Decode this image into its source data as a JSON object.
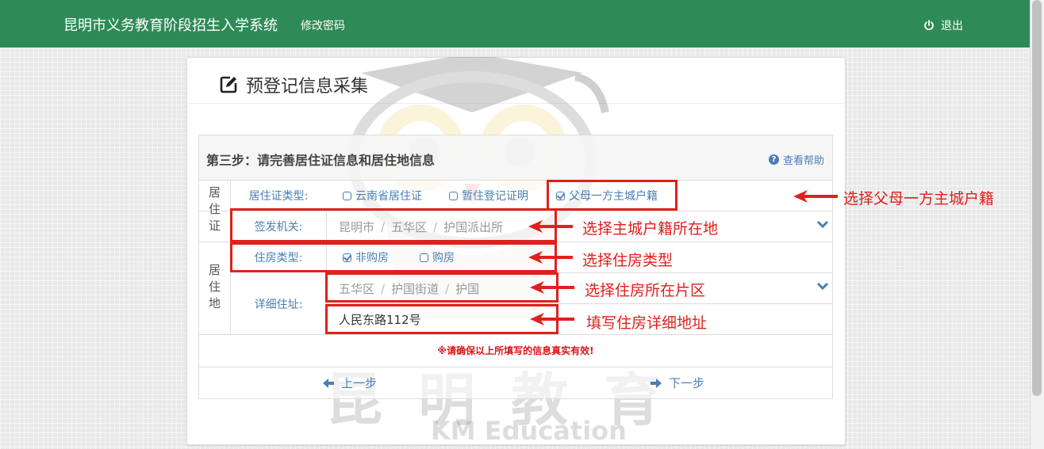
{
  "header": {
    "app_title": "昆明市义务教育阶段招生入学系统",
    "change_password": "修改密码",
    "logout": "退出"
  },
  "panel": {
    "title": "预登记信息采集"
  },
  "form": {
    "step_title": "第三步：请完善居住证信息和居住地信息",
    "help": "查看帮助",
    "residence_permit_group": "居住证",
    "residence_group": "居住地",
    "permit_type": {
      "label": "居住证类型:",
      "options": [
        {
          "label": "云南省居住证",
          "checked": false
        },
        {
          "label": "暂住登记证明",
          "checked": false
        },
        {
          "label": "父母一方主城户籍",
          "checked": true
        }
      ]
    },
    "issuing_authority": {
      "label": "签发机关:",
      "path": [
        "昆明市",
        "五华区",
        "护国派出所"
      ]
    },
    "housing_type": {
      "label": "住房类型:",
      "options": [
        {
          "label": "非购房",
          "checked": true
        },
        {
          "label": "购房",
          "checked": false
        }
      ]
    },
    "address": {
      "label": "详细住址:",
      "area_path": [
        "五华区",
        "护国街道",
        "护国"
      ],
      "detail_value": "人民东路112号"
    },
    "notice": "※请确保以上所填写的信息真实有效!",
    "prev_button": "上一步",
    "next_button": "下一步"
  },
  "annotations": {
    "permit_type": "选择父母一方主城户籍",
    "issuing_authority": "选择主城户籍所在地",
    "housing_type": "选择住房类型",
    "address_area": "选择住房所在片区",
    "address_detail": "填写住房详细地址"
  },
  "watermark": {
    "cn": "昆 明 教 育",
    "en": "KM Education"
  },
  "colors": {
    "header_green": "#2e8b57",
    "link_blue": "#4a7fb5",
    "annotation_red": "#e0201d"
  }
}
